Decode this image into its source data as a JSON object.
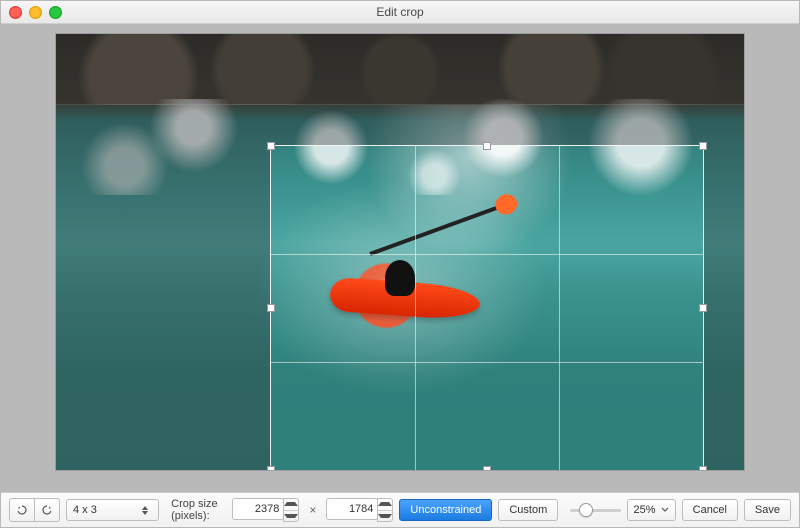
{
  "window": {
    "title": "Edit crop"
  },
  "ratio": {
    "selected": "4 x 3"
  },
  "crop": {
    "label": "Crop size (pixels):",
    "width": "2378",
    "height": "1784",
    "separator": "×"
  },
  "constraint": {
    "mode_label": "Unconstrained",
    "custom_label": "Custom"
  },
  "zoom": {
    "value": "25%"
  },
  "actions": {
    "cancel": "Cancel",
    "save": "Save"
  },
  "icons": {
    "undo": "undo-icon",
    "redo": "redo-icon",
    "ratio_dropdown": "up-down-chevron-icon",
    "zoom_dropdown": "down-chevron-icon"
  }
}
